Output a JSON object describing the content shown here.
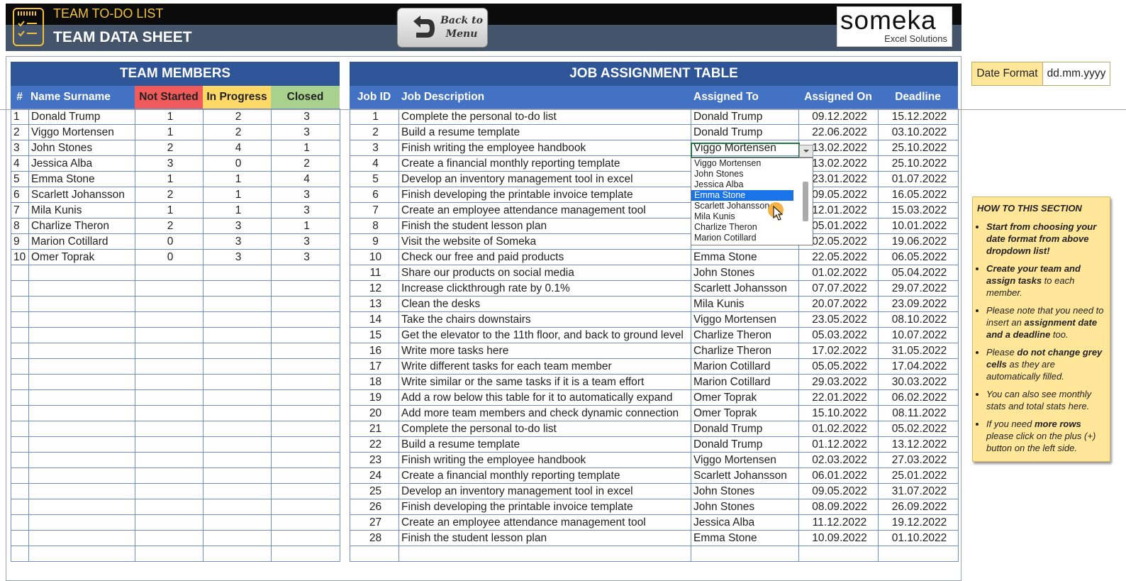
{
  "header": {
    "app_title": "TEAM TO-DO LIST",
    "sheet_title": "TEAM DATA SHEET",
    "back_button": "Back to\nMenu",
    "logo_word": "someka",
    "logo_sub": "Excel Solutions"
  },
  "team_table": {
    "title": "TEAM MEMBERS",
    "columns": [
      "#",
      "Name Surname",
      "Not Started",
      "In Progress",
      "Closed"
    ],
    "rows": [
      [
        "1",
        "Donald Trump",
        "1",
        "2",
        "3"
      ],
      [
        "2",
        "Viggo Mortensen",
        "1",
        "2",
        "3"
      ],
      [
        "3",
        "John Stones",
        "2",
        "4",
        "1"
      ],
      [
        "4",
        "Jessica Alba",
        "3",
        "0",
        "2"
      ],
      [
        "5",
        "Emma Stone",
        "1",
        "1",
        "4"
      ],
      [
        "6",
        "Scarlett Johansson",
        "2",
        "1",
        "3"
      ],
      [
        "7",
        "Mila Kunis",
        "1",
        "1",
        "3"
      ],
      [
        "8",
        "Charlize Theron",
        "2",
        "3",
        "1"
      ],
      [
        "9",
        "Marion Cotillard",
        "0",
        "3",
        "3"
      ],
      [
        "10",
        "Omer Toprak",
        "0",
        "3",
        "3"
      ]
    ],
    "empty_rows": 19,
    "colors": {
      "not_started": "#f05a5a",
      "in_progress": "#ffd966",
      "closed": "#a9d18e"
    }
  },
  "job_table": {
    "title": "JOB ASSIGNMENT TABLE",
    "columns": [
      "Job ID",
      "Job Description",
      "Assigned To",
      "Assigned On",
      "Deadline"
    ],
    "rows": [
      [
        "1",
        "Complete the personal to-do list",
        "Donald Trump",
        "09.12.2022",
        "15.12.2022"
      ],
      [
        "2",
        "Build a resume template",
        "Donald Trump",
        "22.06.2022",
        "03.10.2022"
      ],
      [
        "3",
        "Finish writing the employee handbook",
        "Viggo Mortensen",
        "13.02.2022",
        "25.10.2022"
      ],
      [
        "4",
        "Create a financial monthly reporting template",
        "",
        "13.02.2022",
        "25.10.2022"
      ],
      [
        "5",
        "Develop an inventory management tool in excel",
        "",
        "23.01.2022",
        "01.07.2022"
      ],
      [
        "6",
        "Finish developing the printable invoice template",
        "",
        "09.05.2022",
        "16.05.2022"
      ],
      [
        "7",
        "Create an employee attendance management tool",
        "",
        "12.01.2022",
        "15.03.2022"
      ],
      [
        "8",
        "Finish the student lesson plan",
        "",
        "05.01.2022",
        "10.01.2022"
      ],
      [
        "9",
        "Visit the website of Someka",
        "Emma Stone",
        "02.05.2022",
        "19.06.2022"
      ],
      [
        "10",
        "Check our free and paid products",
        "Emma Stone",
        "22.05.2022",
        "06.05.2022"
      ],
      [
        "11",
        "Share our products on social media",
        "John Stones",
        "01.02.2022",
        "05.04.2022"
      ],
      [
        "12",
        "Increase clickthrough rate by 0.1%",
        "Scarlett Johansson",
        "07.07.2022",
        "29.07.2022"
      ],
      [
        "13",
        "Clean the desks",
        "Mila Kunis",
        "20.07.2022",
        "23.09.2022"
      ],
      [
        "14",
        "Take the chairs downstairs",
        "Viggo Mortensen",
        "23.05.2022",
        "08.10.2022"
      ],
      [
        "15",
        "Get the elevator to the 11th floor, and back to ground level",
        "Charlize Theron",
        "05.03.2022",
        "10.07.2022"
      ],
      [
        "16",
        "Write more tasks here",
        "Charlize Theron",
        "17.02.2022",
        "31.05.2022"
      ],
      [
        "17",
        "Write different tasks for each team member",
        "Marion Cotillard",
        "05.05.2022",
        "17.04.2022"
      ],
      [
        "18",
        "Write similar or the same tasks if it is a team effort",
        "Marion Cotillard",
        "29.03.2022",
        "30.03.2022"
      ],
      [
        "19",
        "Add a row below this table for it to automatically expand",
        "Omer Toprak",
        "22.01.2022",
        "06.02.2022"
      ],
      [
        "20",
        "Add more team members and check dynamic connection",
        "Omer Toprak",
        "15.10.2022",
        "08.11.2022"
      ],
      [
        "21",
        "Complete the personal to-do list",
        "Donald Trump",
        "01.02.2022",
        "05.02.2022"
      ],
      [
        "22",
        "Build a resume template",
        "Donald Trump",
        "01.12.2022",
        "13.12.2022"
      ],
      [
        "23",
        "Finish writing the employee handbook",
        "Viggo Mortensen",
        "02.03.2022",
        "27.03.2022"
      ],
      [
        "24",
        "Create a financial monthly reporting template",
        "Scarlett Johansson",
        "06.01.2022",
        "25.01.2022"
      ],
      [
        "25",
        "Develop an inventory management tool in excel",
        "John Stones",
        "09.05.2022",
        "31.07.2022"
      ],
      [
        "26",
        "Finish developing the printable invoice template",
        "John Stones",
        "08.09.2022",
        "26.09.2022"
      ],
      [
        "27",
        "Create an employee attendance management tool",
        "Jessica Alba",
        "11.12.2022",
        "19.12.2022"
      ],
      [
        "28",
        "Finish the student lesson plan",
        "Emma Stone",
        "10.09.2022",
        "01.10.2022"
      ]
    ]
  },
  "dropdown": {
    "options": [
      "Viggo Mortensen",
      "John Stones",
      "Jessica Alba",
      "Emma Stone",
      "Scarlett Johansson",
      "Mila Kunis",
      "Charlize Theron",
      "Marion Cotillard"
    ],
    "selected_index": 3
  },
  "date_format": {
    "label": "Date  Format",
    "value": "dd.mm.yyyy"
  },
  "help": {
    "title": "HOW TO THIS SECTION",
    "items": [
      "<b>Start from choosing your date format from above dropdown list!</b>",
      "<b>Create your team and assign tasks</b> to each member.",
      "Please note that you need to insert an <b>assignment date and a deadline</b> too.",
      "Please <b>do not change grey cells</b> as they are automatically filled.",
      "You can also see monthly stats and total stats here.",
      "If you need <b>more rows</b> please click on the plus (+) button on the left side."
    ]
  }
}
